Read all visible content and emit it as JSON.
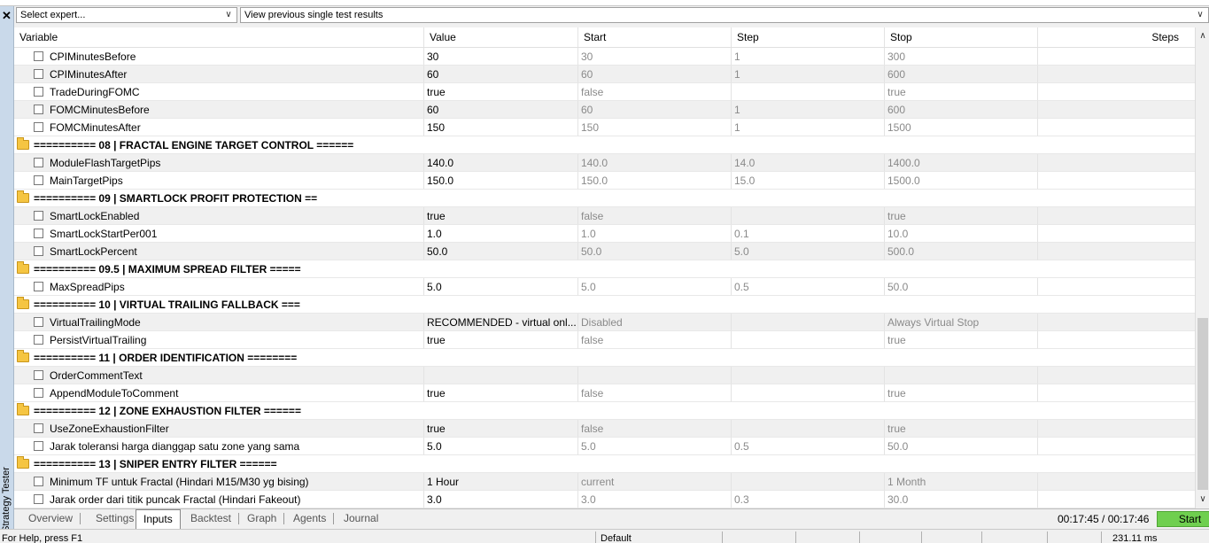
{
  "side_panel": {
    "close_symbol": "✕",
    "title": "Strategy Tester"
  },
  "toolbar": {
    "expert_select": "Select expert...",
    "results_select": "View previous single test results"
  },
  "columns": [
    "Variable",
    "Value",
    "Start",
    "Step",
    "Stop",
    "Steps"
  ],
  "rows": [
    {
      "type": "param",
      "name": "CPIMinutesBefore",
      "value": "30",
      "start": "30",
      "step": "1",
      "stop": "300"
    },
    {
      "type": "param",
      "name": "CPIMinutesAfter",
      "value": "60",
      "start": "60",
      "step": "1",
      "stop": "600"
    },
    {
      "type": "param",
      "name": "TradeDuringFOMC",
      "value": "true",
      "start": "false",
      "step": "",
      "stop": "true"
    },
    {
      "type": "param",
      "name": "FOMCMinutesBefore",
      "value": "60",
      "start": "60",
      "step": "1",
      "stop": "600"
    },
    {
      "type": "param",
      "name": "FOMCMinutesAfter",
      "value": "150",
      "start": "150",
      "step": "1",
      "stop": "1500"
    },
    {
      "type": "group",
      "name": "========== 08 | FRACTAL ENGINE TARGET CONTROL ======"
    },
    {
      "type": "param",
      "name": "ModuleFlashTargetPips",
      "value": "140.0",
      "start": "140.0",
      "step": "14.0",
      "stop": "1400.0"
    },
    {
      "type": "param",
      "name": "MainTargetPips",
      "value": "150.0",
      "start": "150.0",
      "step": "15.0",
      "stop": "1500.0"
    },
    {
      "type": "group",
      "name": "========== 09 | SMARTLOCK PROFIT PROTECTION =="
    },
    {
      "type": "param",
      "name": "SmartLockEnabled",
      "value": "true",
      "start": "false",
      "step": "",
      "stop": "true"
    },
    {
      "type": "param",
      "name": "SmartLockStartPer001",
      "value": "1.0",
      "start": "1.0",
      "step": "0.1",
      "stop": "10.0"
    },
    {
      "type": "param",
      "name": "SmartLockPercent",
      "value": "50.0",
      "start": "50.0",
      "step": "5.0",
      "stop": "500.0"
    },
    {
      "type": "group",
      "name": "========== 09.5 | MAXIMUM SPREAD FILTER ====="
    },
    {
      "type": "param",
      "name": "MaxSpreadPips",
      "value": "5.0",
      "start": "5.0",
      "step": "0.5",
      "stop": "50.0"
    },
    {
      "type": "group",
      "name": "========== 10 | VIRTUAL TRAILING FALLBACK ==="
    },
    {
      "type": "param",
      "name": "VirtualTrailingMode",
      "value": "RECOMMENDED - virtual onl...",
      "start": "Disabled",
      "step": "",
      "stop": "Always Virtual Stop"
    },
    {
      "type": "param",
      "name": "PersistVirtualTrailing",
      "value": "true",
      "start": "false",
      "step": "",
      "stop": "true"
    },
    {
      "type": "group",
      "name": "========== 11 | ORDER IDENTIFICATION ========"
    },
    {
      "type": "param",
      "name": "OrderCommentText",
      "value": "",
      "start": "",
      "step": "",
      "stop": ""
    },
    {
      "type": "param",
      "name": "AppendModuleToComment",
      "value": "true",
      "start": "false",
      "step": "",
      "stop": "true"
    },
    {
      "type": "group",
      "name": "========== 12 | ZONE EXHAUSTION FILTER ======"
    },
    {
      "type": "param",
      "name": "UseZoneExhaustionFilter",
      "value": "true",
      "start": "false",
      "step": "",
      "stop": "true"
    },
    {
      "type": "param",
      "name": "Jarak toleransi harga dianggap satu zone yang sama",
      "value": "5.0",
      "start": "5.0",
      "step": "0.5",
      "stop": "50.0"
    },
    {
      "type": "group",
      "name": "========== 13 | SNIPER ENTRY FILTER ======"
    },
    {
      "type": "param",
      "name": "Minimum TF untuk Fractal (Hindari M15/M30 yg bising)",
      "value": "1 Hour",
      "start": "current",
      "step": "",
      "stop": "1 Month"
    },
    {
      "type": "param",
      "name": "Jarak order dari titik puncak Fractal (Hindari Fakeout)",
      "value": "3.0",
      "start": "3.0",
      "step": "0.3",
      "stop": "30.0"
    }
  ],
  "tabs": [
    "Overview",
    "Settings",
    "Inputs",
    "Backtest",
    "Graph",
    "Agents",
    "Journal"
  ],
  "active_tab": "Inputs",
  "timer": "00:17:45 / 00:17:46",
  "start_button": "Start",
  "status_bar": {
    "help": "For Help, press F1",
    "profile": "Default",
    "ping": "231.11 ms"
  },
  "colors": {
    "start_button": "#6fcf4f",
    "side_strip": "#c9d9ea",
    "alt_row": "#f0f0f0"
  }
}
